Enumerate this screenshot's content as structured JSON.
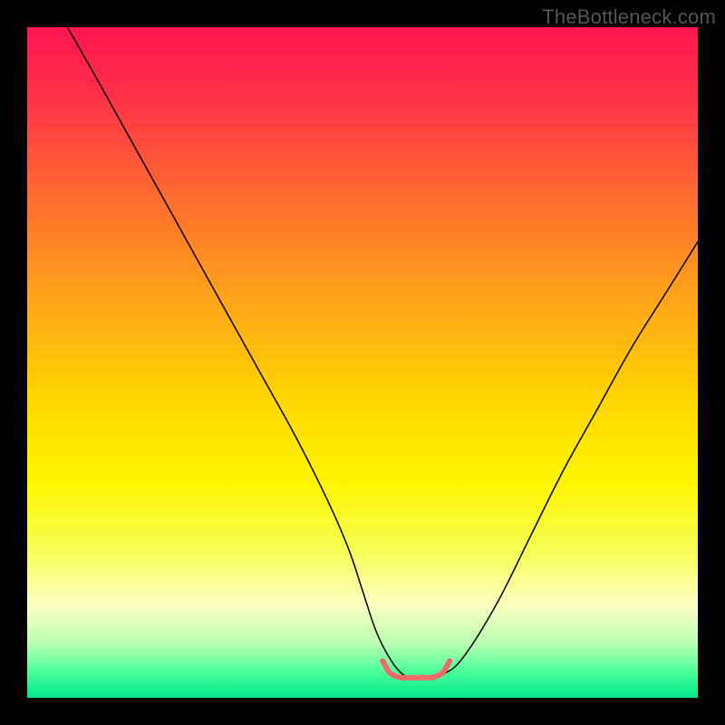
{
  "watermark": "TheBottleneck.com",
  "gradient_stops": [
    {
      "offset": 0.0,
      "color": "#ff1552"
    },
    {
      "offset": 0.1,
      "color": "#ff2f49"
    },
    {
      "offset": 0.25,
      "color": "#ff6a30"
    },
    {
      "offset": 0.4,
      "color": "#ffa21a"
    },
    {
      "offset": 0.55,
      "color": "#ffd400"
    },
    {
      "offset": 0.68,
      "color": "#fff500"
    },
    {
      "offset": 0.78,
      "color": "#f6ff54"
    },
    {
      "offset": 0.86,
      "color": "#ffffc0"
    },
    {
      "offset": 0.92,
      "color": "#b6ffb0"
    },
    {
      "offset": 0.96,
      "color": "#4dff9a"
    },
    {
      "offset": 1.0,
      "color": "#00e78a"
    }
  ],
  "chart_data": {
    "type": "line",
    "title": "",
    "xlabel": "",
    "ylabel": "",
    "xlim": [
      0,
      100
    ],
    "ylim": [
      0,
      100
    ],
    "grid": false,
    "series": [
      {
        "name": "curve",
        "color": "#000000",
        "width": 1.5,
        "x": [
          6,
          10,
          15,
          20,
          25,
          30,
          35,
          40,
          45,
          48,
          50,
          52,
          54,
          56,
          58,
          60,
          62,
          65,
          70,
          75,
          80,
          85,
          90,
          95,
          100
        ],
        "y": [
          100,
          93,
          84,
          75,
          66,
          57,
          48,
          39,
          29,
          22,
          16,
          10,
          6,
          3.5,
          3,
          3,
          3.5,
          6,
          14,
          24,
          34,
          43,
          52,
          60,
          68
        ]
      },
      {
        "name": "bottom-marker",
        "color": "#ee6b6b",
        "width": 6,
        "x": [
          53,
          54,
          55,
          56,
          57,
          58,
          59,
          60,
          61,
          62,
          63
        ],
        "y": [
          5.5,
          3.8,
          3.2,
          3.0,
          3.0,
          3.0,
          3.0,
          3.0,
          3.2,
          3.8,
          5.5
        ]
      }
    ]
  }
}
